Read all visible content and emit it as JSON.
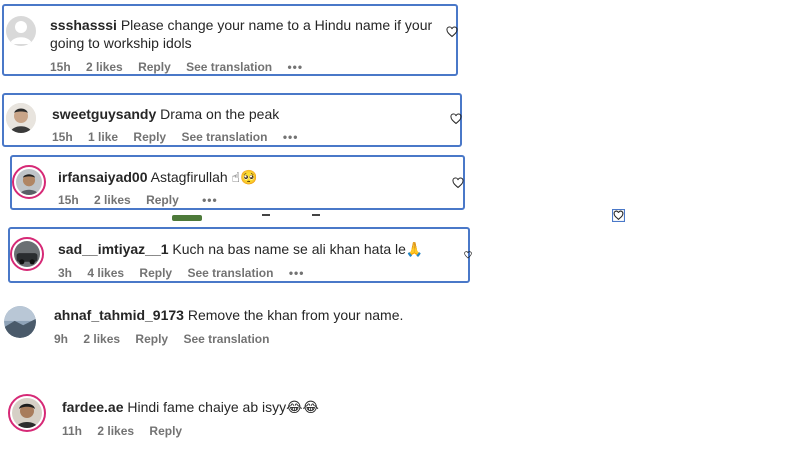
{
  "comments": [
    {
      "username": "ssshasssi",
      "text": "Please change your name to a Hindu name if your going to workship idols",
      "time": "15h",
      "likes": "2 likes",
      "reply": "Reply",
      "translation": "See translation",
      "more": "•••"
    },
    {
      "username": "sweetguysandy",
      "text": "Drama on the peak",
      "time": "15h",
      "likes": "1 like",
      "reply": "Reply",
      "translation": "See translation",
      "more": "•••"
    },
    {
      "username": "irfansaiyad00",
      "text": "Astagfirullah ☝🥺",
      "time": "15h",
      "likes": "2 likes",
      "reply": "Reply",
      "more": "•••"
    },
    {
      "username": "sad__imtiyaz__1",
      "text": "Kuch na bas name se ali khan hata le🙏",
      "time": "3h",
      "likes": "4 likes",
      "reply": "Reply",
      "translation": "See translation",
      "more": "•••"
    },
    {
      "username": "ahnaf_tahmid_9173",
      "text": "Remove the khan from your name.",
      "time": "9h",
      "likes": "2 likes",
      "reply": "Reply",
      "translation": "See translation"
    },
    {
      "username": "fardee.ae",
      "text": "Hindi fame chaiye ab isyy😂😂",
      "time": "11h",
      "likes": "2 likes",
      "reply": "Reply"
    }
  ],
  "icons": {
    "like": "heart-icon",
    "more": "more-options-icon"
  },
  "colors": {
    "highlight_border": "#4a78c8",
    "story_ring": "#d62976",
    "meta_text": "#737373"
  }
}
